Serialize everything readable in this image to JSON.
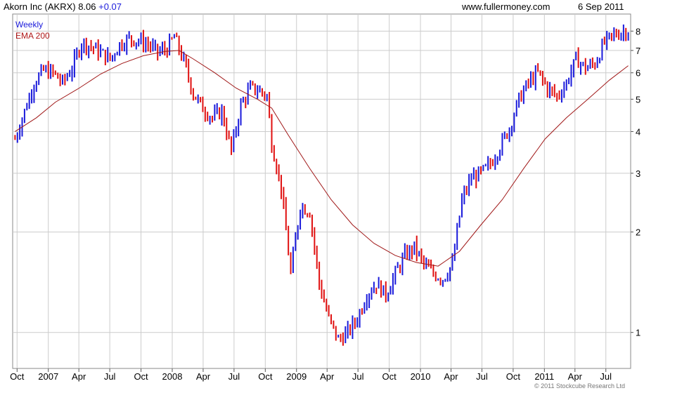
{
  "header": {
    "ticker_title": "Akorn Inc (AKRX) 8.06",
    "change": "+0.07",
    "site": "www.fullermoney.com",
    "date": "6 Sep 2011"
  },
  "legend": {
    "weekly": "Weekly",
    "ema": "EMA 200"
  },
  "footer": {
    "copyright": "© 2011 Stockcube Research Ltd"
  },
  "colors": {
    "up": "#1a1adb",
    "down": "#e01010",
    "ema": "#a01818",
    "grid": "#cccccc"
  },
  "chart_data": {
    "type": "line",
    "title": "Akorn Inc (AKRX) 8.06 +0.07",
    "y_scale": "log",
    "ylim": [
      0.78,
      9.0
    ],
    "grid": true,
    "y_ticks": [
      1,
      2,
      3,
      4,
      5,
      6,
      7,
      8
    ],
    "x_ticks": [
      {
        "label": "Oct",
        "date": "2006-10-01"
      },
      {
        "label": "2007",
        "date": "2007-01-01"
      },
      {
        "label": "Apr",
        "date": "2007-04-01"
      },
      {
        "label": "Jul",
        "date": "2007-07-01"
      },
      {
        "label": "Oct",
        "date": "2007-10-01"
      },
      {
        "label": "2008",
        "date": "2008-01-01"
      },
      {
        "label": "Apr",
        "date": "2008-04-01"
      },
      {
        "label": "Jul",
        "date": "2008-07-01"
      },
      {
        "label": "Oct",
        "date": "2008-10-01"
      },
      {
        "label": "2009",
        "date": "2009-01-01"
      },
      {
        "label": "Apr",
        "date": "2009-04-01"
      },
      {
        "label": "Jul",
        "date": "2009-07-01"
      },
      {
        "label": "Oct",
        "date": "2009-10-01"
      },
      {
        "label": "2010",
        "date": "2010-01-01"
      },
      {
        "label": "Apr",
        "date": "2010-04-01"
      },
      {
        "label": "Jul",
        "date": "2010-07-01"
      },
      {
        "label": "Oct",
        "date": "2010-10-01"
      },
      {
        "label": "2011",
        "date": "2011-01-01"
      },
      {
        "label": "Apr",
        "date": "2011-04-01"
      },
      {
        "label": "Jul",
        "date": "2011-07-01"
      }
    ],
    "series": [
      {
        "name": "Weekly",
        "points": [
          [
            "2006-09-25",
            3.8
          ],
          [
            "2006-10-23",
            4.6
          ],
          [
            "2006-11-20",
            5.6
          ],
          [
            "2006-12-18",
            6.1
          ],
          [
            "2007-01-15",
            6.0
          ],
          [
            "2007-02-12",
            5.6
          ],
          [
            "2007-03-12",
            6.2
          ],
          [
            "2007-04-09",
            7.4
          ],
          [
            "2007-05-07",
            7.2
          ],
          [
            "2007-06-04",
            6.9
          ],
          [
            "2007-07-02",
            6.6
          ],
          [
            "2007-07-30",
            7.3
          ],
          [
            "2007-08-27",
            7.6
          ],
          [
            "2007-09-24",
            7.5
          ],
          [
            "2007-10-22",
            7.3
          ],
          [
            "2007-11-19",
            6.9
          ],
          [
            "2007-12-17",
            7.1
          ],
          [
            "2008-01-07",
            7.7
          ],
          [
            "2008-02-04",
            6.5
          ],
          [
            "2008-03-03",
            5.2
          ],
          [
            "2008-03-31",
            4.7
          ],
          [
            "2008-04-28",
            4.4
          ],
          [
            "2008-05-26",
            4.6
          ],
          [
            "2008-06-23",
            3.5
          ],
          [
            "2008-07-21",
            4.8
          ],
          [
            "2008-08-18",
            5.4
          ],
          [
            "2008-09-15",
            5.3
          ],
          [
            "2008-10-06",
            5.1
          ],
          [
            "2008-10-20",
            3.7
          ],
          [
            "2008-11-17",
            2.7
          ],
          [
            "2008-12-15",
            1.5
          ],
          [
            "2009-01-12",
            2.4
          ],
          [
            "2009-02-09",
            2.3
          ],
          [
            "2009-03-09",
            1.4
          ],
          [
            "2009-04-06",
            1.1
          ],
          [
            "2009-05-04",
            0.95
          ],
          [
            "2009-06-01",
            1.0
          ],
          [
            "2009-06-29",
            1.1
          ],
          [
            "2009-07-27",
            1.3
          ],
          [
            "2009-08-24",
            1.4
          ],
          [
            "2009-09-21",
            1.3
          ],
          [
            "2009-10-19",
            1.5
          ],
          [
            "2009-11-16",
            1.7
          ],
          [
            "2009-12-14",
            1.8
          ],
          [
            "2010-01-11",
            1.6
          ],
          [
            "2010-02-08",
            1.5
          ],
          [
            "2010-03-08",
            1.45
          ],
          [
            "2010-04-05",
            1.6
          ],
          [
            "2010-05-03",
            2.5
          ],
          [
            "2010-05-31",
            2.9
          ],
          [
            "2010-06-28",
            3.0
          ],
          [
            "2010-07-26",
            3.2
          ],
          [
            "2010-08-23",
            3.6
          ],
          [
            "2010-09-20",
            4.1
          ],
          [
            "2010-10-18",
            5.0
          ],
          [
            "2010-11-15",
            5.6
          ],
          [
            "2010-12-13",
            6.0
          ],
          [
            "2011-01-10",
            5.4
          ],
          [
            "2011-02-07",
            5.1
          ],
          [
            "2011-03-07",
            5.6
          ],
          [
            "2011-04-04",
            6.6
          ],
          [
            "2011-05-02",
            6.2
          ],
          [
            "2011-05-30",
            6.4
          ],
          [
            "2011-06-27",
            7.4
          ],
          [
            "2011-07-25",
            7.8
          ],
          [
            "2011-08-22",
            8.0
          ],
          [
            "2011-09-05",
            8.06
          ]
        ]
      },
      {
        "name": "EMA 200",
        "points": [
          [
            "2006-09-25",
            4.0
          ],
          [
            "2006-11-27",
            4.4
          ],
          [
            "2007-01-22",
            4.9
          ],
          [
            "2007-04-02",
            5.4
          ],
          [
            "2007-06-04",
            5.95
          ],
          [
            "2007-08-06",
            6.4
          ],
          [
            "2007-10-08",
            6.75
          ],
          [
            "2007-12-10",
            6.95
          ],
          [
            "2008-01-21",
            7.0
          ],
          [
            "2008-03-03",
            6.6
          ],
          [
            "2008-05-05",
            6.0
          ],
          [
            "2008-07-07",
            5.4
          ],
          [
            "2008-09-08",
            5.0
          ],
          [
            "2008-10-20",
            4.7
          ],
          [
            "2008-12-08",
            3.9
          ],
          [
            "2009-02-09",
            3.1
          ],
          [
            "2009-04-13",
            2.5
          ],
          [
            "2009-06-15",
            2.1
          ],
          [
            "2009-08-17",
            1.85
          ],
          [
            "2009-10-19",
            1.7
          ],
          [
            "2009-12-21",
            1.62
          ],
          [
            "2010-02-22",
            1.58
          ],
          [
            "2010-04-26",
            1.75
          ],
          [
            "2010-06-28",
            2.1
          ],
          [
            "2010-08-30",
            2.5
          ],
          [
            "2010-11-01",
            3.1
          ],
          [
            "2011-01-03",
            3.8
          ],
          [
            "2011-03-07",
            4.4
          ],
          [
            "2011-05-09",
            5.0
          ],
          [
            "2011-07-11",
            5.7
          ],
          [
            "2011-09-05",
            6.3
          ]
        ]
      }
    ]
  }
}
